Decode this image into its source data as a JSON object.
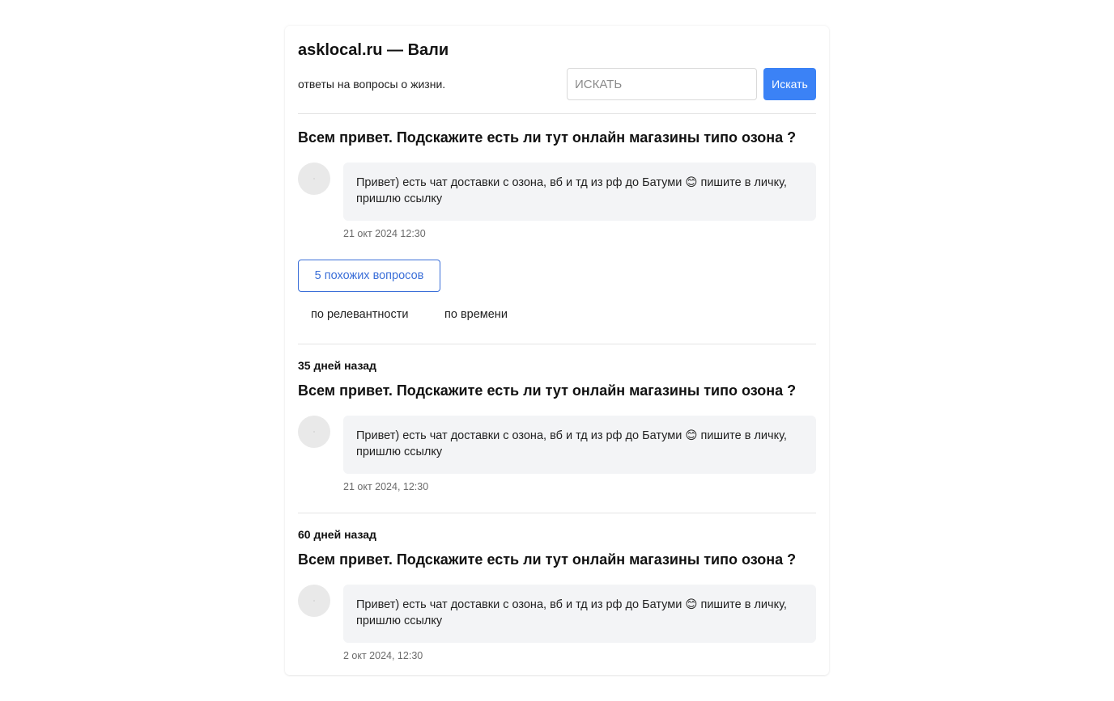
{
  "header": {
    "title": "asklocal.ru — Вали",
    "tagline": "ответы на вопросы о жизни.",
    "search_placeholder": "ИСКАТЬ",
    "search_button": "Искать"
  },
  "main_question": {
    "title": "Всем привет. Подскажите есть ли тут онлайн магазины типо озона ?",
    "answer": "Привет) есть чат доставки с озона, вб и тд из рф до Батуми 😊 пишите в личку, пришлю ссылку",
    "timestamp": "21 окт 2024 12:30"
  },
  "similar": {
    "button_label": "5 похожих вопросов",
    "sort_options": [
      "по релевантности",
      "по времени"
    ]
  },
  "related": [
    {
      "days_ago": "35 дней назад",
      "title": "Всем привет. Подскажите есть ли тут онлайн магазины типо озона ?",
      "answer": "Привет) есть чат доставки с озона, вб и тд из рф до Батуми 😊 пишите в личку, пришлю ссылку",
      "timestamp": "21 окт 2024, 12:30"
    },
    {
      "days_ago": "60 дней назад",
      "title": "Всем привет. Подскажите есть ли тут онлайн магазины типо озона ?",
      "answer": "Привет) есть чат доставки с озона, вб и тд из рф до Батуми 😊 пишите в личку, пришлю ссылку",
      "timestamp": "2 окт 2024, 12:30"
    }
  ],
  "colors": {
    "accent": "#3b82f6",
    "bubble_bg": "#f3f4f6"
  }
}
